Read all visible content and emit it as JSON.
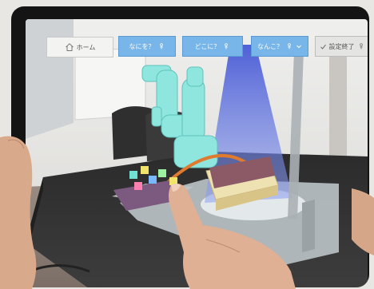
{
  "toolbar": {
    "home_label": "ホーム",
    "what_label": "なにを？",
    "where_label": "どこに？",
    "how_label": "なんこ？",
    "done_label": "設定終了"
  },
  "icons": {
    "home": "home-icon",
    "touch": "touch-icon",
    "dropdown": "chevron-down-icon",
    "check": "check-icon"
  },
  "colors": {
    "toolbar_button": "#78b5e8",
    "hologram_robot": "#8ee6df",
    "spotlight": "#3a4fd6",
    "path_arc": "#e07a2f",
    "tray": "#e8d9a6"
  }
}
